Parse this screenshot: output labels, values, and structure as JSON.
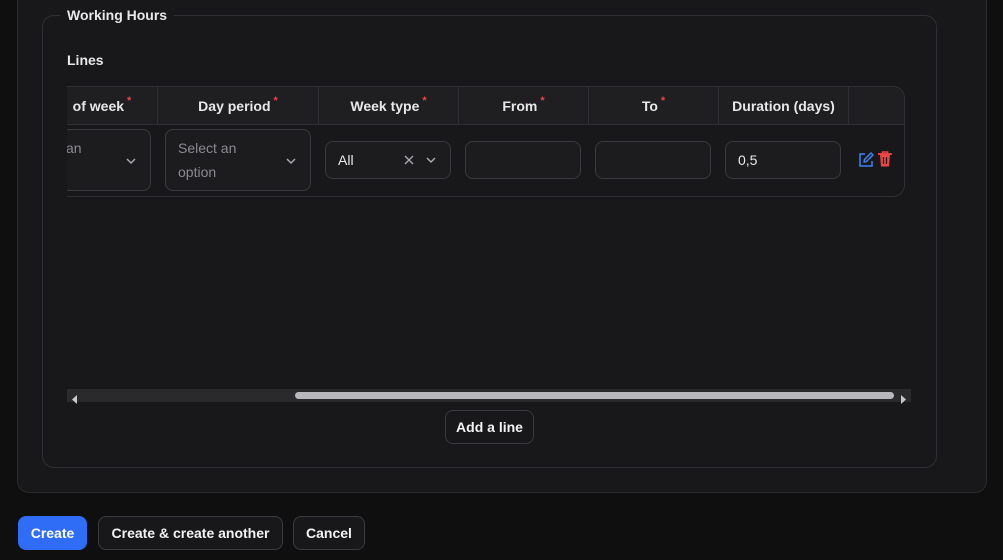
{
  "section": {
    "legend": "Working Hours",
    "lines_label": "Lines"
  },
  "table": {
    "columns": [
      {
        "label": "of week",
        "required": "*"
      },
      {
        "label": "Day period",
        "required": "*"
      },
      {
        "label": "Week type",
        "required": "*"
      },
      {
        "label": "From",
        "required": "*"
      },
      {
        "label": "To",
        "required": "*"
      },
      {
        "label": "Duration (days)",
        "required": ""
      }
    ],
    "row": {
      "day_of_week_placeholder_line1": "an",
      "day_period_placeholder_line1": "Select an",
      "day_period_placeholder_line2": "option",
      "week_type_value": "All",
      "from_value": "",
      "to_value": "",
      "duration_value": "0,5"
    }
  },
  "buttons": {
    "add_line": "Add a line",
    "create": "Create",
    "create_another": "Create & create another",
    "cancel": "Cancel"
  },
  "colors": {
    "accent": "#2f6df6",
    "danger": "#ef4444",
    "edit": "#3b82f6"
  },
  "icons": [
    "chevron-down-icon",
    "clear-x-icon",
    "edit-icon",
    "trash-icon",
    "scroll-left-icon",
    "scroll-right-icon"
  ]
}
